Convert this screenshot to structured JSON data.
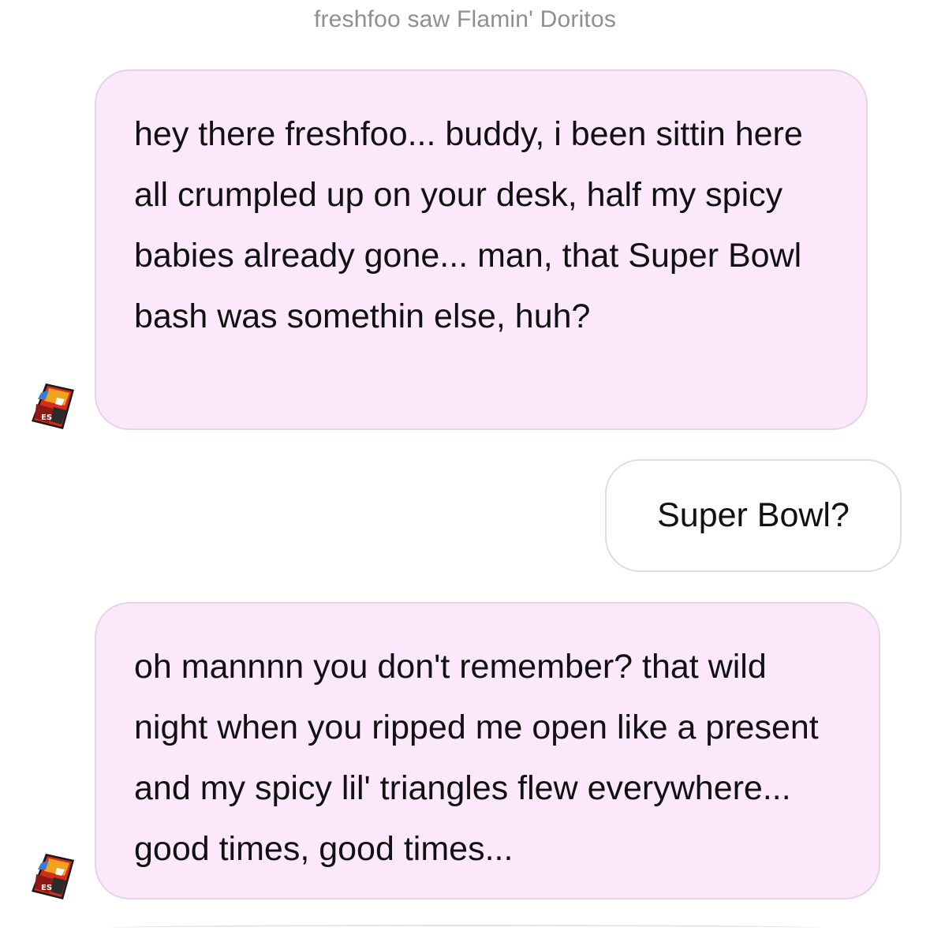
{
  "header": {
    "status_text": "freshfoo saw Flamin' Doritos"
  },
  "contact": {
    "avatar_icon": "doritos-bag-icon"
  },
  "messages": [
    {
      "sender": "bot",
      "text": "hey there freshfoo... buddy, i been sittin here all crumpled up on your desk, half my spicy babies already gone... man, that Super Bowl bash was somethin else, huh?"
    },
    {
      "sender": "user",
      "text": "Super Bowl?"
    },
    {
      "sender": "bot",
      "text": "oh mannnn you don't remember? that wild night when you ripped me open like a present and my spicy lil' triangles flew everywhere... good times, good times..."
    }
  ],
  "colors": {
    "incoming_bubble": "#fbe9fb",
    "incoming_border": "#e4d4e6",
    "outgoing_bubble": "#ffffff",
    "status_text": "#8e8e93"
  }
}
